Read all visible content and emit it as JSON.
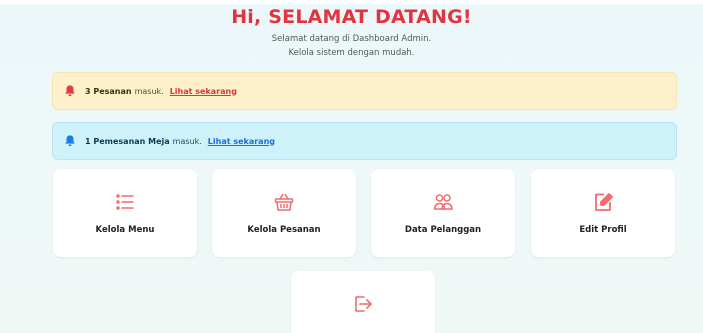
{
  "header": {
    "title": "Hi, SELAMAT DATANG!",
    "subtitle_line1": "Selamat datang di Dashboard Admin.",
    "subtitle_line2": "Kelola sistem dengan mudah."
  },
  "alerts": [
    {
      "count": "3 Pesanan",
      "text": "masuk.",
      "link": "Lihat sekarang",
      "type": "warning",
      "icon": "bell-icon"
    },
    {
      "count": "1 Pemesanan Meja",
      "text": "masuk.",
      "link": "Lihat sekarang",
      "type": "info",
      "icon": "bell-icon"
    }
  ],
  "cards": [
    {
      "label": "Kelola Menu",
      "icon": "list-icon"
    },
    {
      "label": "Kelola Pesanan",
      "icon": "basket-icon"
    },
    {
      "label": "Data Pelanggan",
      "icon": "users-icon"
    },
    {
      "label": "Edit Profil",
      "icon": "edit-icon"
    },
    {
      "label": "",
      "icon": "logout-icon"
    }
  ],
  "colors": {
    "accent": "#e0353f",
    "icon": "#f36b6b",
    "warning_bg": "#fdf0cb",
    "info_bg": "#cff1fa",
    "warning_link": "#d43a3a",
    "info_link": "#1a6fd6"
  }
}
